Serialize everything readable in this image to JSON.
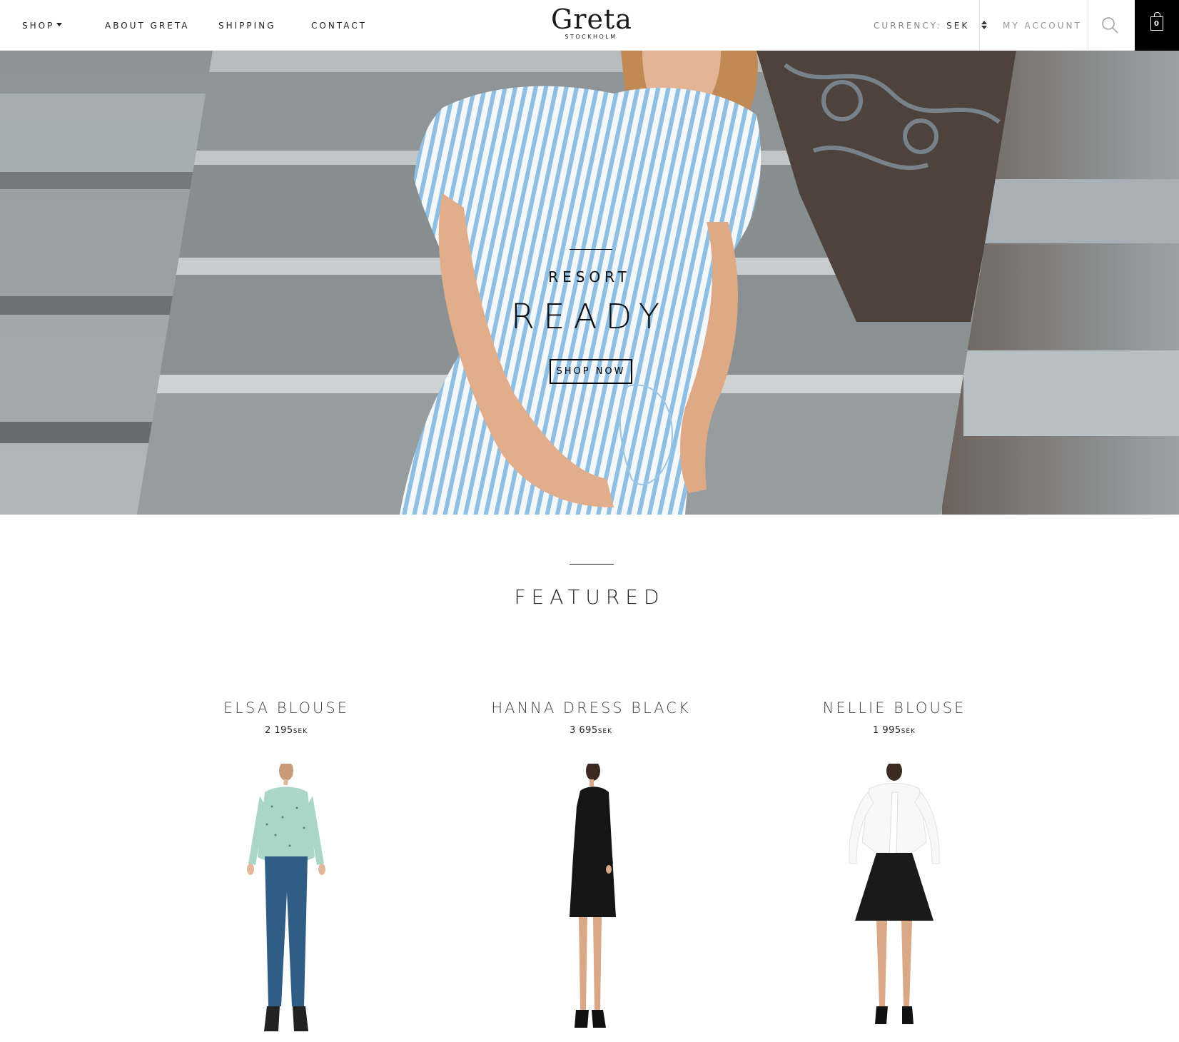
{
  "header": {
    "nav": [
      {
        "label": "SHOP"
      },
      {
        "label": "ABOUT GRETA"
      },
      {
        "label": "SHIPPING"
      },
      {
        "label": "CONTACT"
      }
    ],
    "logo": {
      "word": "Greta",
      "sub": "STOCKHOLM"
    },
    "currency": {
      "label": "CURRENCY:",
      "value": "SEK"
    },
    "account_label": "MY ACCOUNT",
    "cart_count": "0"
  },
  "hero": {
    "subtitle": "RESORT",
    "title": "READY",
    "cta_label": "SHOP NOW"
  },
  "featured": {
    "title": "FEATURED",
    "products": [
      {
        "name": "ELSA BLOUSE",
        "price": "2 195",
        "currency": "SEK",
        "top_color": "#a9d6c6",
        "bottom_color": "#2f5d86"
      },
      {
        "name": "HANNA DRESS BLACK",
        "price": "3 695",
        "currency": "SEK",
        "top_color": "#151515",
        "bottom_color": "#151515"
      },
      {
        "name": "NELLIE BLOUSE",
        "price": "1 995",
        "currency": "SEK",
        "top_color": "#f8f8f8",
        "bottom_color": "#1a1a1a"
      }
    ]
  },
  "colors": {
    "accent": "#000000",
    "stone": "#9ea6ab",
    "dress_stripe": "#8fc0e4"
  }
}
